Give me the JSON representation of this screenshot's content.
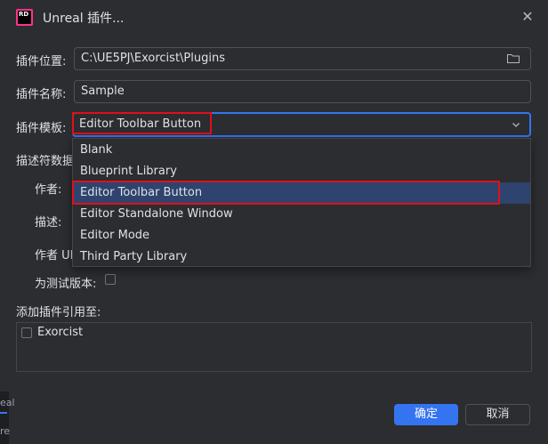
{
  "window": {
    "title": "Unreal 插件...",
    "logo_text": "RD",
    "close_icon": "close-icon"
  },
  "form": {
    "location_label": "插件位置:",
    "location_value": "C:\\UE5PJ\\Exorcist\\Plugins",
    "name_label": "插件名称:",
    "name_value": "Sample",
    "template_label": "插件模板:",
    "template_value": "Editor Toolbar Button",
    "descriptor_label": "描述符数据",
    "author_label": "作者:",
    "description_label": "描述:",
    "author_url_label": "作者 UI",
    "beta_label": "为测试版本:"
  },
  "dropdown": {
    "options": [
      "Blank",
      "Blueprint Library",
      "Editor Toolbar Button",
      "Editor Standalone Window",
      "Editor Mode",
      "Third Party Library"
    ],
    "selected_index": 2
  },
  "references": {
    "label": "添加插件引用至:",
    "items": [
      {
        "name": "Exorcist",
        "checked": false
      }
    ]
  },
  "buttons": {
    "ok": "确定",
    "cancel": "取消"
  },
  "background_edge": {
    "line1": "eal",
    "line2": "re"
  },
  "colors": {
    "accent": "#3574f0",
    "selection": "#2e436e",
    "highlight_box": "#e0101a",
    "logo": "#ff318c"
  }
}
